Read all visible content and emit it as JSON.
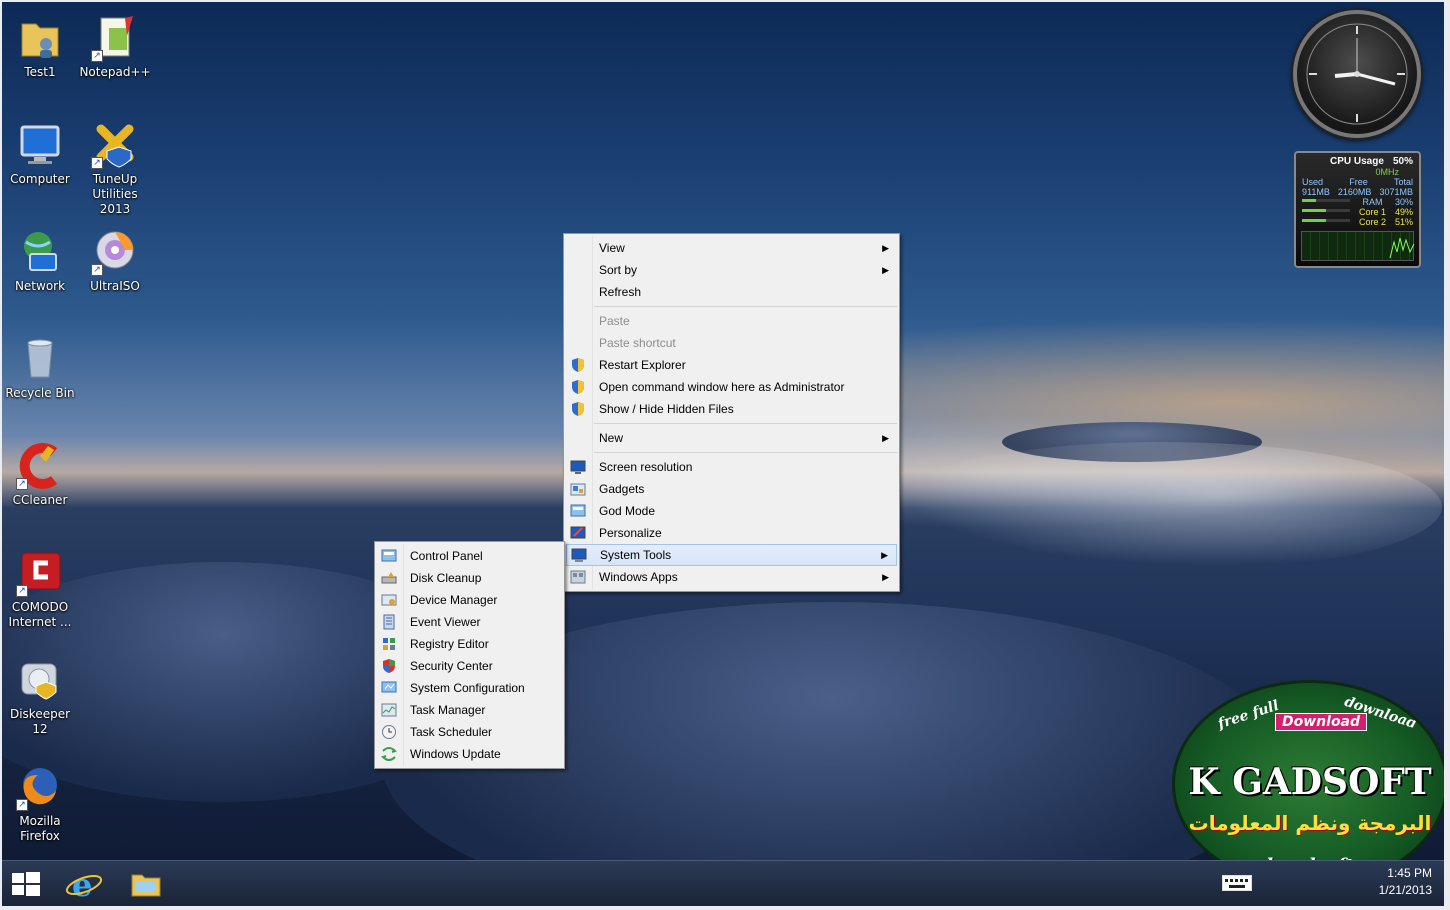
{
  "desktop_icons": [
    {
      "label": "Test1",
      "icon": "user-folder-icon"
    },
    {
      "label": "Notepad++",
      "icon": "notepad-plus-plus-icon"
    },
    {
      "label": "Computer",
      "icon": "computer-icon"
    },
    {
      "label": "TuneUp Utilities 2013",
      "icon": "tuneup-icon"
    },
    {
      "label": "Network",
      "icon": "network-icon"
    },
    {
      "label": "UltraISO",
      "icon": "ultraiso-icon"
    },
    {
      "label": "Recycle Bin",
      "icon": "recycle-bin-icon"
    },
    {
      "label": "CCleaner",
      "icon": "ccleaner-icon"
    },
    {
      "label": "COMODO Internet ...",
      "icon": "comodo-icon"
    },
    {
      "label": "Diskeeper 12",
      "icon": "diskeeper-icon"
    },
    {
      "label": "Mozilla Firefox",
      "icon": "firefox-icon"
    }
  ],
  "cpu_gadget": {
    "title": "CPU Usage",
    "usage": "50%",
    "mhz": "0MHz",
    "col_used": "Used",
    "col_free": "Free",
    "col_total": "Total",
    "used": "911MB",
    "free": "2160MB",
    "total": "3071MB",
    "ram_label": "RAM",
    "ram_pct": "30%",
    "ram_value": 0.3,
    "core1_label": "Core 1",
    "core1_pct": "49%",
    "core1_value": 0.49,
    "core2_label": "Core 2",
    "core2_pct": "51%",
    "core2_value": 0.51
  },
  "context_menu": {
    "view": "View",
    "sort_by": "Sort by",
    "refresh": "Refresh",
    "paste": "Paste",
    "paste_shortcut": "Paste shortcut",
    "restart_explorer": "Restart Explorer",
    "open_cmd_admin": "Open command window here as Administrator",
    "show_hide_hidden": "Show / Hide Hidden Files",
    "new": "New",
    "screen_resolution": "Screen resolution",
    "gadgets": "Gadgets",
    "god_mode": "God Mode",
    "personalize": "Personalize",
    "system_tools": "System Tools",
    "windows_apps": "Windows Apps"
  },
  "system_tools_submenu": [
    {
      "label": "Control Panel",
      "icon": "control-panel-icon"
    },
    {
      "label": "Disk Cleanup",
      "icon": "disk-cleanup-icon"
    },
    {
      "label": "Device Manager",
      "icon": "device-manager-icon"
    },
    {
      "label": "Event Viewer",
      "icon": "event-viewer-icon"
    },
    {
      "label": "Registry Editor",
      "icon": "registry-editor-icon"
    },
    {
      "label": "Security Center",
      "icon": "security-center-icon"
    },
    {
      "label": "System Configuration",
      "icon": "system-configuration-icon"
    },
    {
      "label": "Task Manager",
      "icon": "task-manager-icon"
    },
    {
      "label": "Task Scheduler",
      "icon": "task-scheduler-icon"
    },
    {
      "label": "Windows Update",
      "icon": "windows-update-icon"
    }
  ],
  "taskbar": {
    "time": "1:45 PM",
    "date": "1/21/2013"
  },
  "watermark": {
    "line1": "free full",
    "line2": "download",
    "badge": "Download",
    "name": "K GADSOFT",
    "arabic": "البرمجة ونظم المعلومات",
    "footer": "kgadsoft"
  },
  "colors": {
    "menu_bg": "#f0f0f0",
    "menu_highlight": "#d6e5f7",
    "taskbar": "#1a2438"
  }
}
